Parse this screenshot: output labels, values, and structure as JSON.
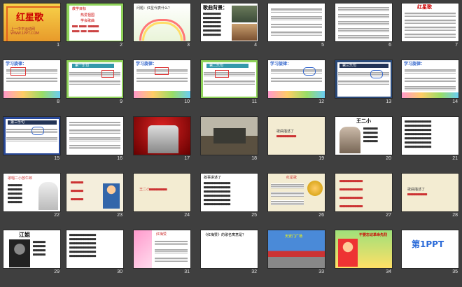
{
  "slides": [
    {
      "n": "1",
      "title": "红星歌",
      "sub": "上一中平运动网 WWW.1PPT.COM"
    },
    {
      "n": "2",
      "text": "教学目标",
      "lines": [
        "热爱祖国",
        "学会歌曲"
      ]
    },
    {
      "n": "3",
      "text": "问题：红星代表什么？"
    },
    {
      "n": "4",
      "text": "歌曲背景："
    },
    {
      "n": "5",
      "text": ""
    },
    {
      "n": "6",
      "text": ""
    },
    {
      "n": "7",
      "text": "红星歌"
    },
    {
      "n": "8",
      "text": "学习旋律："
    },
    {
      "n": "9",
      "text": "第一乐句"
    },
    {
      "n": "10",
      "text": "学习旋律："
    },
    {
      "n": "11",
      "text": "第二乐句"
    },
    {
      "n": "12",
      "text": "学习旋律："
    },
    {
      "n": "13",
      "text": "第三乐句"
    },
    {
      "n": "14",
      "text": "学习旋律："
    },
    {
      "n": "15",
      "text": "第三乐句"
    },
    {
      "n": "16",
      "text": ""
    },
    {
      "n": "17",
      "text": ""
    },
    {
      "n": "18",
      "text": ""
    },
    {
      "n": "19",
      "text": "歌曲描述了"
    },
    {
      "n": "20",
      "text": "王二小"
    },
    {
      "n": "21",
      "text": ""
    },
    {
      "n": "22",
      "text": "歌唱二小放牛郎"
    },
    {
      "n": "23",
      "text": ""
    },
    {
      "n": "24",
      "text": "王二小"
    },
    {
      "n": "25",
      "text": "故事讲述了"
    },
    {
      "n": "26",
      "text": "红星歌"
    },
    {
      "n": "27",
      "text": ""
    },
    {
      "n": "28",
      "text": "歌曲描述了"
    },
    {
      "n": "29",
      "text": "江姐"
    },
    {
      "n": "30",
      "text": ""
    },
    {
      "n": "31",
      "text": "红梅赞"
    },
    {
      "n": "32",
      "text": "《红梅赞》的歌名寓意是？"
    },
    {
      "n": "33",
      "text": "天安门广场"
    },
    {
      "n": "34",
      "text": "不要忘记革命先烈"
    },
    {
      "n": "35",
      "text": "第1PPT"
    }
  ],
  "colors": {
    "bg": "#3f3f3f",
    "title_red": "#c00000",
    "green": "#7ec850",
    "yellow": "#f5d400"
  }
}
